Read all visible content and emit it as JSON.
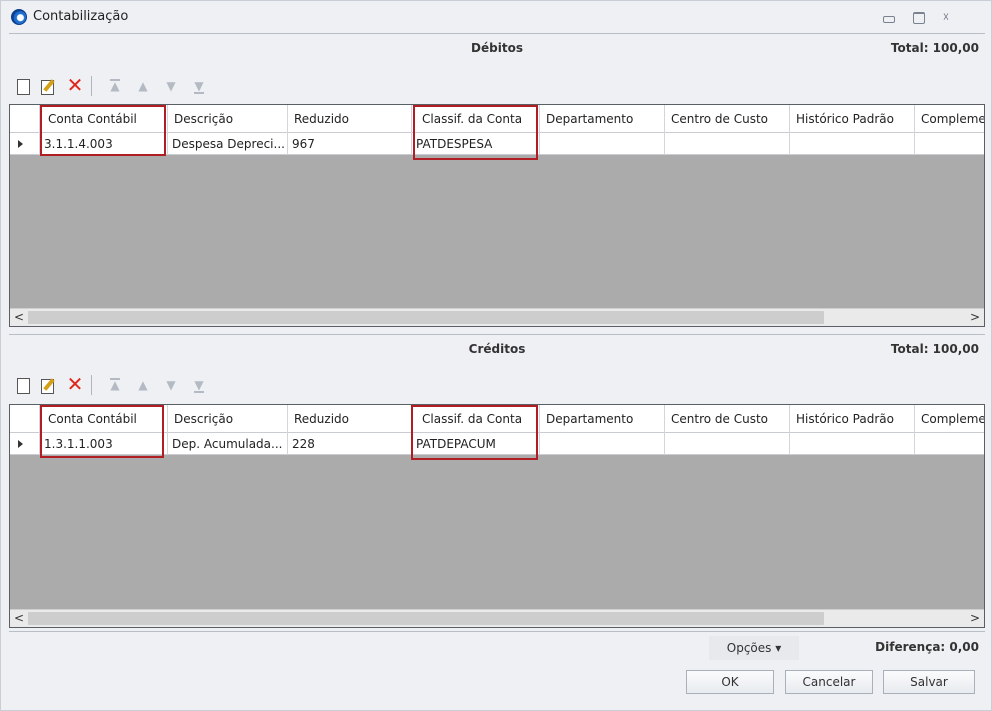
{
  "window": {
    "title": "Contabilização"
  },
  "debitos": {
    "title": "Débitos",
    "total": "Total: 100,00",
    "columns": [
      "Conta Contábil",
      "Descrição",
      "Reduzido",
      "Classif. da Conta",
      "Departamento",
      "Centro de Custo",
      "Histórico Padrão",
      "Complemen"
    ],
    "row": {
      "conta": "3.1.1.4.003",
      "descricao": "Despesa Depreci...",
      "reduzido": "967",
      "classif": "PATDESPESA"
    }
  },
  "creditos": {
    "title": "Créditos",
    "total": "Total: 100,00",
    "columns": [
      "Conta Contábil",
      "Descrição",
      "Reduzido",
      "Classif. da Conta",
      "Departamento",
      "Centro de Custo",
      "Histórico Padrão",
      "Complemen"
    ],
    "row": {
      "conta": "1.3.1.1.003",
      "descricao": "Dep. Acumulada...",
      "reduzido": "228",
      "classif": "PATDEPACUM"
    }
  },
  "toolbar": {
    "icons": [
      "new-icon",
      "edit-icon",
      "delete-icon",
      "move-first-icon",
      "move-up-icon",
      "move-down-icon",
      "move-last-icon"
    ]
  },
  "footer": {
    "opcoes": "Opções ▾",
    "diferenca": "Diferença: 0,00",
    "ok": "OK",
    "cancelar": "Cancelar",
    "salvar": "Salvar"
  },
  "colors": {
    "highlight": "#b01e23",
    "grid_empty": "#ababab",
    "delete": "#e0261b"
  }
}
